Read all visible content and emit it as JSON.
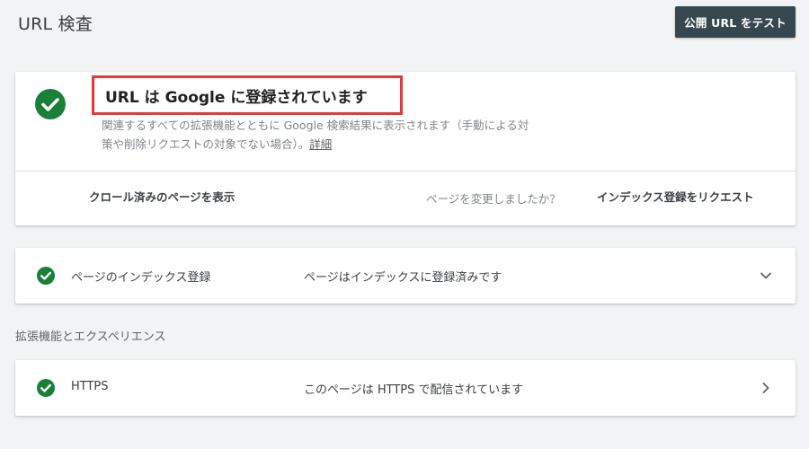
{
  "header": {
    "title": "URL 検査",
    "test_button_label": "公開 URL をテスト"
  },
  "status_card": {
    "title": "URL は Google に登録されています",
    "description_line1": "関連するすべての拡張機能とともに Google 検索結果に表示されます（手動による対",
    "description_line2": "策や削除リクエストの対象でない場合）。",
    "details_link": "詳細",
    "view_crawled_label": "クロール済みのページを表示",
    "changed_question": "ページを変更しましたか？",
    "request_index_label": "インデックス登録をリクエスト"
  },
  "index_row": {
    "label": "ページのインデックス登録",
    "value": "ページはインデックスに登録済みです"
  },
  "enhancements": {
    "heading": "拡張機能とエクスペリエンス"
  },
  "https_row": {
    "label": "HTTPS",
    "value": "このページは HTTPS で配信されています"
  },
  "colors": {
    "check_green": "#188038",
    "button_dark": "#37474f",
    "highlight_red": "#e53935",
    "background": "#f1f3f4"
  },
  "icons": {
    "status": "check-circle-icon",
    "index_chevron": "chevron-down-icon",
    "https_chevron": "chevron-right-icon"
  }
}
